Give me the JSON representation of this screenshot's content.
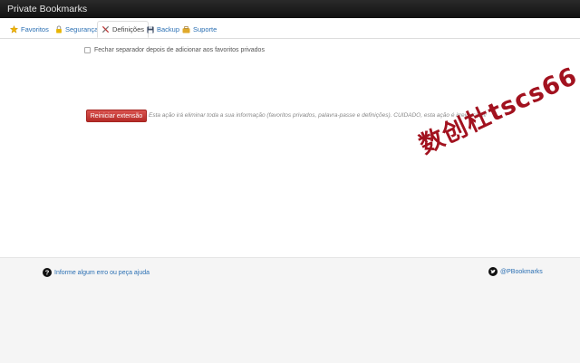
{
  "app": {
    "title": "Private Bookmarks"
  },
  "tabs": [
    {
      "label": "Favoritos",
      "icon": "star-icon"
    },
    {
      "label": "Segurança",
      "icon": "lock-icon"
    },
    {
      "label": "Definições",
      "icon": "tools-icon",
      "active": true
    },
    {
      "label": "Backup",
      "icon": "floppy-disk-icon"
    },
    {
      "label": "Suporte",
      "icon": "support-icon"
    }
  ],
  "settings": {
    "close_tab_label": "Fechar separador depois de adicionar aos favoritos privados",
    "close_tab_checked": false,
    "reset_button_label": "Reiniciar extensão",
    "reset_warning": "Esta ação irá eliminar toda a sua informação (favoritos privados, palavra-passe e definições). CUIDADO, esta ação é irreversível!"
  },
  "watermark": {
    "text": "数创杜tscs66"
  },
  "footer": {
    "help_label": "Informe algum erro ou peça ajuda",
    "twitter_label": "@PBookmarks"
  },
  "colors": {
    "link": "#2a6fb3",
    "danger": "#c9302c",
    "titlebar": "#1a1a1a",
    "footer_bg": "#f5f5f5",
    "watermark": "#a2121f"
  }
}
